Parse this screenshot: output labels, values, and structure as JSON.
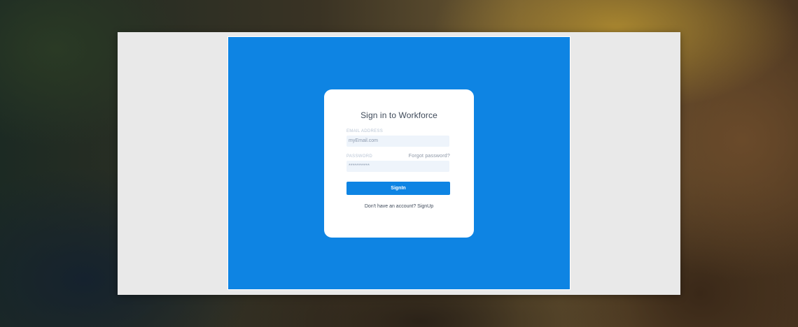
{
  "login": {
    "title": "Sign in to Workforce",
    "email_label": "EMAIL ADDRESS",
    "email_placeholder": "myEmail.com",
    "password_label": "PASSWORD",
    "password_value": "***********",
    "forgot_password": "Forgot password?",
    "submit_label": "SignIn",
    "signup_prompt": "Don't have an account? ",
    "signup_link": "SignUp"
  },
  "colors": {
    "screen_background": "#0e84e3",
    "button": "#0e84e3",
    "input_background": "#eef4fb",
    "card": "#ffffff",
    "frame": "#e9e9e9"
  }
}
